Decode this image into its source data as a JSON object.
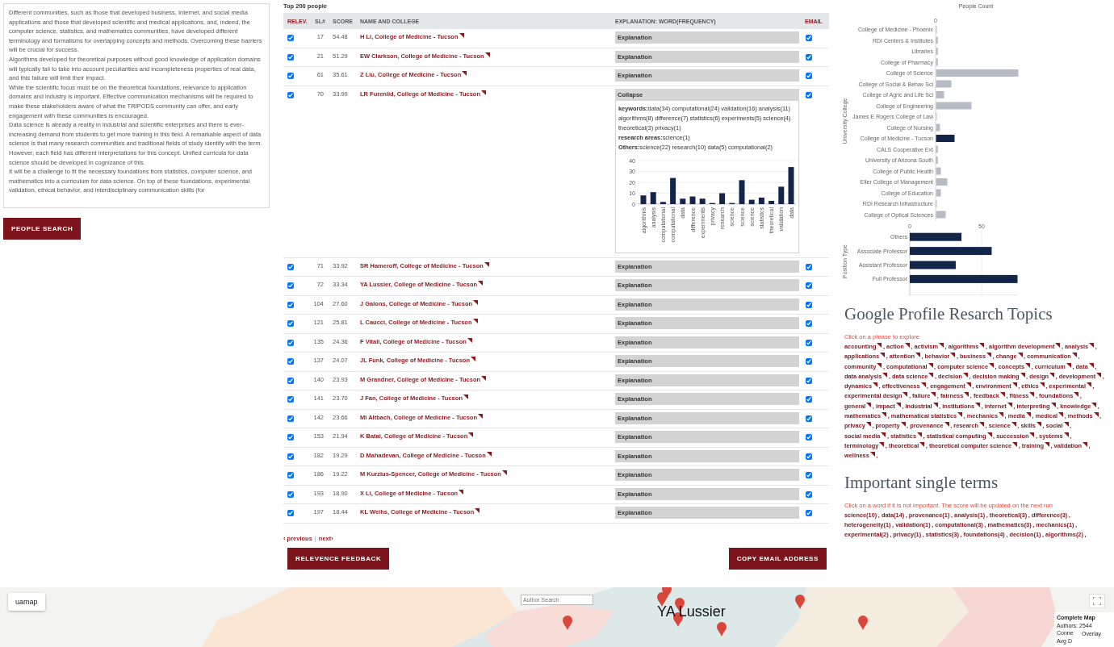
{
  "query": {
    "paragraphs": [
      "Different communities, such as those that developed business, Internet, and social media applications and those that developed scientific and medical applications, and, indeed, the computer science, statistics, and mathematics communities, have developed different terminology and formalisms for overlapping concepts and methods. Overcoming these barriers will be crucial for success.",
      "Algorithms developed for theoretical purposes without good knowledge of application domains will typically fail to take into account peculiarities and incompleteness properties of real data, and this failure will limit their impact.",
      "While the scientific focus must be on the theoretical foundations, relevance to application domains and industry is important. Effective communication mechanisms will be required to make these stakeholders aware of what the TRIPODS community can offer, and early engagement with these communities is encouraged.",
      "Data science is already a reality in industrial and scientific enterprises and there is ever-increasing demand from students to get more training in this field. A remarkable aspect of data science is that many research communities and traditional fields of study identify with the term. However, each field has different interpretations for this concept. Unified curricula for data science should be developed in cognizance of this.",
      "It will be a challenge to fit the necessary foundations from statistics, computer science, and mathematics into a curriculum for data science. On top of these foundations, experimental validation, ethical behavior, and interdisciplinary communication skills (for"
    ]
  },
  "search_button": "PEOPLE SEARCH",
  "people": {
    "title": "Top 200 people",
    "columns": [
      {
        "label": "RELEV.",
        "accent": true
      },
      {
        "label": "SL#",
        "accent": false
      },
      {
        "label": "SCORE",
        "accent": false
      },
      {
        "label": "NAME AND COLLEGE",
        "accent": false
      },
      {
        "label": "EXPLANATION: WORD(FREQUENCY)",
        "accent": false
      },
      {
        "label": "EMAIL",
        "accent": true
      }
    ],
    "rows": [
      {
        "relevant": true,
        "sl": "17",
        "score": "54.48",
        "name": "H Li, College of Medicine - Tucson",
        "explanation": "Explanation",
        "expanded": false,
        "email": true
      },
      {
        "relevant": true,
        "sl": "21",
        "score": "51.29",
        "name": "EW Clarkson, College of Medicine - Tucson",
        "explanation": "Explanation",
        "expanded": false,
        "email": true
      },
      {
        "relevant": true,
        "sl": "61",
        "score": "35.61",
        "name": "Z Liu, College of Medicine - Tucson",
        "explanation": "Explanation",
        "expanded": false,
        "email": true
      },
      {
        "relevant": true,
        "sl": "70",
        "score": "33.99",
        "name": "LR Furenlid, College of Medicine - Tucson",
        "explanation": "Collapse",
        "expanded": true,
        "email": true,
        "details": {
          "lines": [
            "**keywords:**data(34) computational(24) validation(16) analysis(11) algorithms(8) difference(7) statistics(6) experiments(5) science(4) theoretical(3) privacy(1)",
            "**research areas:**science(1)",
            "**Others:**science(22) research(10) data(5) computational(2)"
          ],
          "chart_data": {
            "type": "bar",
            "categories": [
              "algorithms",
              "analysis",
              "computational",
              "computational",
              "data",
              "difference",
              "experiments",
              "privacy",
              "research",
              "science",
              "science",
              "science",
              "statistics",
              "theoretical",
              "validation",
              "data"
            ],
            "values": [
              8,
              11,
              2,
              24,
              5,
              7,
              5,
              1,
              10,
              1,
              22,
              4,
              6,
              3,
              16,
              34
            ],
            "ylim": [
              0,
              40
            ],
            "yticks": [
              0,
              10,
              20,
              30,
              40
            ],
            "grid": true
          }
        }
      },
      {
        "relevant": true,
        "sl": "71",
        "score": "33.92",
        "name": "SR Hameroff, College of Medicine - Tucson",
        "explanation": "Explanation",
        "expanded": false,
        "email": true
      },
      {
        "relevant": true,
        "sl": "72",
        "score": "33.34",
        "name": "YA Lussier, College of Medicine - Tucson",
        "explanation": "Explanation",
        "expanded": false,
        "email": true
      },
      {
        "relevant": true,
        "sl": "104",
        "score": "27.60",
        "name": "J Galons, College of Medicine - Tucson",
        "explanation": "Explanation",
        "expanded": false,
        "email": true
      },
      {
        "relevant": true,
        "sl": "121",
        "score": "25.81",
        "name": "L Caucci, College of Medicine - Tucson",
        "explanation": "Explanation",
        "expanded": false,
        "email": true
      },
      {
        "relevant": true,
        "sl": "135",
        "score": "24.36",
        "name": "F Vitali, College of Medicine - Tucson",
        "explanation": "Explanation",
        "expanded": false,
        "email": true
      },
      {
        "relevant": true,
        "sl": "137",
        "score": "24.07",
        "name": "JL Funk, College of Medicine - Tucson",
        "explanation": "Explanation",
        "expanded": false,
        "email": true
      },
      {
        "relevant": true,
        "sl": "140",
        "score": "23.93",
        "name": "M Grandner, College of Medicine - Tucson",
        "explanation": "Explanation",
        "expanded": false,
        "email": true
      },
      {
        "relevant": true,
        "sl": "141",
        "score": "23.70",
        "name": "J Fan, College of Medicine - Tucson",
        "explanation": "Explanation",
        "expanded": false,
        "email": true
      },
      {
        "relevant": true,
        "sl": "142",
        "score": "23.66",
        "name": "MI Altbach, College of Medicine - Tucson",
        "explanation": "Explanation",
        "expanded": false,
        "email": true
      },
      {
        "relevant": true,
        "sl": "153",
        "score": "21.94",
        "name": "K Batai, College of Medicine - Tucson",
        "explanation": "Explanation",
        "expanded": false,
        "email": true
      },
      {
        "relevant": true,
        "sl": "182",
        "score": "19.29",
        "name": "D Mahadevan, College of Medicine - Tucson",
        "explanation": "Explanation",
        "expanded": false,
        "email": true
      },
      {
        "relevant": true,
        "sl": "186",
        "score": "19.22",
        "name": "M Kurzius-Spencer, College of Medicine - Tucson",
        "explanation": "Explanation",
        "expanded": false,
        "email": true
      },
      {
        "relevant": true,
        "sl": "193",
        "score": "18.90",
        "name": "X Li, College of Medicine - Tucson",
        "explanation": "Explanation",
        "expanded": false,
        "email": true
      },
      {
        "relevant": true,
        "sl": "197",
        "score": "18.44",
        "name": "KL Weihs, College of Medicine - Tucson",
        "explanation": "Explanation",
        "expanded": false,
        "email": true
      }
    ],
    "pagination": {
      "previous": "‹ previous",
      "separator": "|",
      "next": "next›"
    },
    "actions": [
      "RELEVENCE FEEDBACK",
      "COPY EMAIL ADDRESS"
    ]
  },
  "college_chart": {
    "title": "People Count",
    "axis_label": "University College",
    "tick": "0",
    "bars": [
      {
        "label": "College of Medicine - Phoenix",
        "selected": false
      },
      {
        "label": "RDI Centers & Institutes",
        "selected": false
      },
      {
        "label": "Libraries",
        "selected": false
      },
      {
        "label": "College of Pharmacy",
        "selected": false
      },
      {
        "label": "College of Science",
        "selected": false
      },
      {
        "label": "College of Social & Behav Sci",
        "selected": false
      },
      {
        "label": "College of Agric and Life Sci",
        "selected": false
      },
      {
        "label": "College of Engineering",
        "selected": false
      },
      {
        "label": "James E Rogers College of Law",
        "selected": false
      },
      {
        "label": "College of Nursing",
        "selected": false
      },
      {
        "label": "College of Medicine - Tucson",
        "selected": true
      },
      {
        "label": "CALS Cooperative Ext",
        "selected": false
      },
      {
        "label": "University of Arizona South",
        "selected": false
      },
      {
        "label": "College of Public Health",
        "selected": false
      },
      {
        "label": "Eller College of Management",
        "selected": false
      },
      {
        "label": "College of Education",
        "selected": false
      },
      {
        "label": "RDI Research Infrastructure",
        "selected": false
      },
      {
        "label": "College of Optical Sciences",
        "selected": false
      }
    ]
  },
  "position_chart": {
    "chart_data": {
      "type": "bar",
      "orientation": "horizontal",
      "ylabel": "Position Type",
      "categories": [
        "Others",
        "Associate Professor",
        "Assistant Professor",
        "Full Professor"
      ],
      "values": [
        36,
        57,
        32,
        75
      ],
      "xlim": [
        0,
        75
      ],
      "xticks": [
        0,
        50
      ]
    }
  },
  "topics": {
    "heading": "Google Profile Resarch Topics",
    "hint": "Click on a phrase to explore",
    "separator": ",",
    "items": [
      "accounting",
      "action",
      "activism",
      "algorithms",
      "algorithm development",
      "analysis",
      "applications",
      "attention",
      "behavior",
      "business",
      "change",
      "communication",
      "community",
      "computational",
      "computer science",
      "concepts",
      "curriculum",
      "data",
      "data analysis",
      "data science",
      "decision",
      "decision making",
      "design",
      "development",
      "dynamics",
      "effectiveness",
      "engagement",
      "environment",
      "ethics",
      "experimental",
      "experimental design",
      "failure",
      "fairness",
      "feedback",
      "fitness",
      "foundations",
      "general",
      "impact",
      "industrial",
      "institutions",
      "internet",
      "interpreting",
      "knowledge",
      "mathematics",
      "mathematical statistics",
      "mechanics",
      "media",
      "medical",
      "methods",
      "privacy",
      "property",
      "provenance",
      "research",
      "science",
      "skills",
      "social",
      "social media",
      "statistics",
      "statistical computing",
      "succession",
      "systems",
      "terminology",
      "theoretical",
      "theoretical computer science",
      "training",
      "validation",
      "wellness"
    ]
  },
  "terms": {
    "heading": "Important single terms",
    "hint": "Click on a word if it is not important. The score will be updated on the next run",
    "separator": ",",
    "items": [
      "science(10)",
      "data(14)",
      "provenance(1)",
      "analysis(1)",
      "theoretical(3)",
      "difference(3)",
      "heterogeneity(1)",
      "validation(1)",
      "computational(3)",
      "mathematics(3)",
      "mechanics(1)",
      "experimental(2)",
      "privacy(1)",
      "statistics(3)",
      "foundations(4)",
      "decision(1)",
      "algorithms(2)"
    ]
  },
  "map": {
    "button": "uamap",
    "search_placeholder": "Author Search",
    "label": "YA Lussier",
    "info": {
      "title": "Complete Map",
      "lines": [
        "Authors: 2544",
        "Conne",
        "Avg D"
      ]
    },
    "overlay": "Overlay"
  }
}
